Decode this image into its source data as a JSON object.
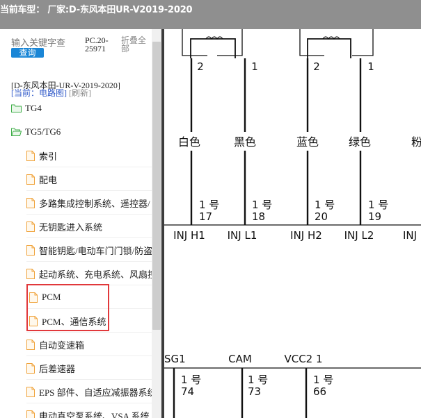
{
  "window": {
    "title": "当前车型：  厂家:D-东风本田UR-V2019-2020"
  },
  "sidebar": {
    "search_placeholder": "输入关键字查",
    "search_button": "查询",
    "pc_code": "PC.20-25971",
    "collapse_all": "折叠全部",
    "car_path": "[D-东风本田-UR-V-2019-2020]",
    "current_label": "[当前：电路图]",
    "refresh_label": "[刷新]",
    "tree": [
      {
        "label": "TG4",
        "type": "folder"
      },
      {
        "label": "TG5/TG6",
        "type": "folder"
      },
      {
        "label": "索引",
        "type": "file"
      },
      {
        "label": "配电",
        "type": "file"
      },
      {
        "label": "多路集成控制系统、遥控器/",
        "type": "file"
      },
      {
        "label": "无钥匙进入系统",
        "type": "file"
      },
      {
        "label": "智能钥匙/电动车门门锁/防盗",
        "type": "file"
      },
      {
        "label": "起动系统、充电系统、风扇控",
        "type": "file"
      },
      {
        "label": "PCM",
        "type": "file"
      },
      {
        "label": "PCM、通信系统",
        "type": "file"
      },
      {
        "label": "自动变速箱",
        "type": "file"
      },
      {
        "label": "后差速器",
        "type": "file"
      },
      {
        "label": "EPS 部件、自适应减振器系统",
        "type": "file"
      },
      {
        "label": "电动真空泵系统、VSA 系统",
        "type": "file"
      }
    ]
  },
  "diagram": {
    "pins_top": [
      "2",
      "1",
      "2",
      "1"
    ],
    "wire_colors": [
      "白色",
      "黑色",
      "蓝色",
      "绿色",
      "粉"
    ],
    "wire_numbers": [
      {
        "label": "1 号",
        "num": "17"
      },
      {
        "label": "1 号",
        "num": "18"
      },
      {
        "label": "1 号",
        "num": "20"
      },
      {
        "label": "1 号",
        "num": "19"
      }
    ],
    "pcm_pins": [
      "INJ H1",
      "INJ L1",
      "INJ H2",
      "INJ L2",
      "INJ"
    ],
    "lower_pins": [
      "SG1",
      "CAM",
      "VCC2 1"
    ],
    "lower_wire_numbers": [
      {
        "label": "1 号",
        "num": "74"
      },
      {
        "label": "1 号",
        "num": "73"
      },
      {
        "label": "1 号",
        "num": "66"
      }
    ]
  },
  "colors": {
    "titlebar": "#8f8f8f",
    "search_button": "#1a86d6",
    "highlight_box": "#e1383b",
    "folder_icon": "#3fae49",
    "file_icon": "#f0a33b",
    "current_text": "#2d57c8"
  }
}
